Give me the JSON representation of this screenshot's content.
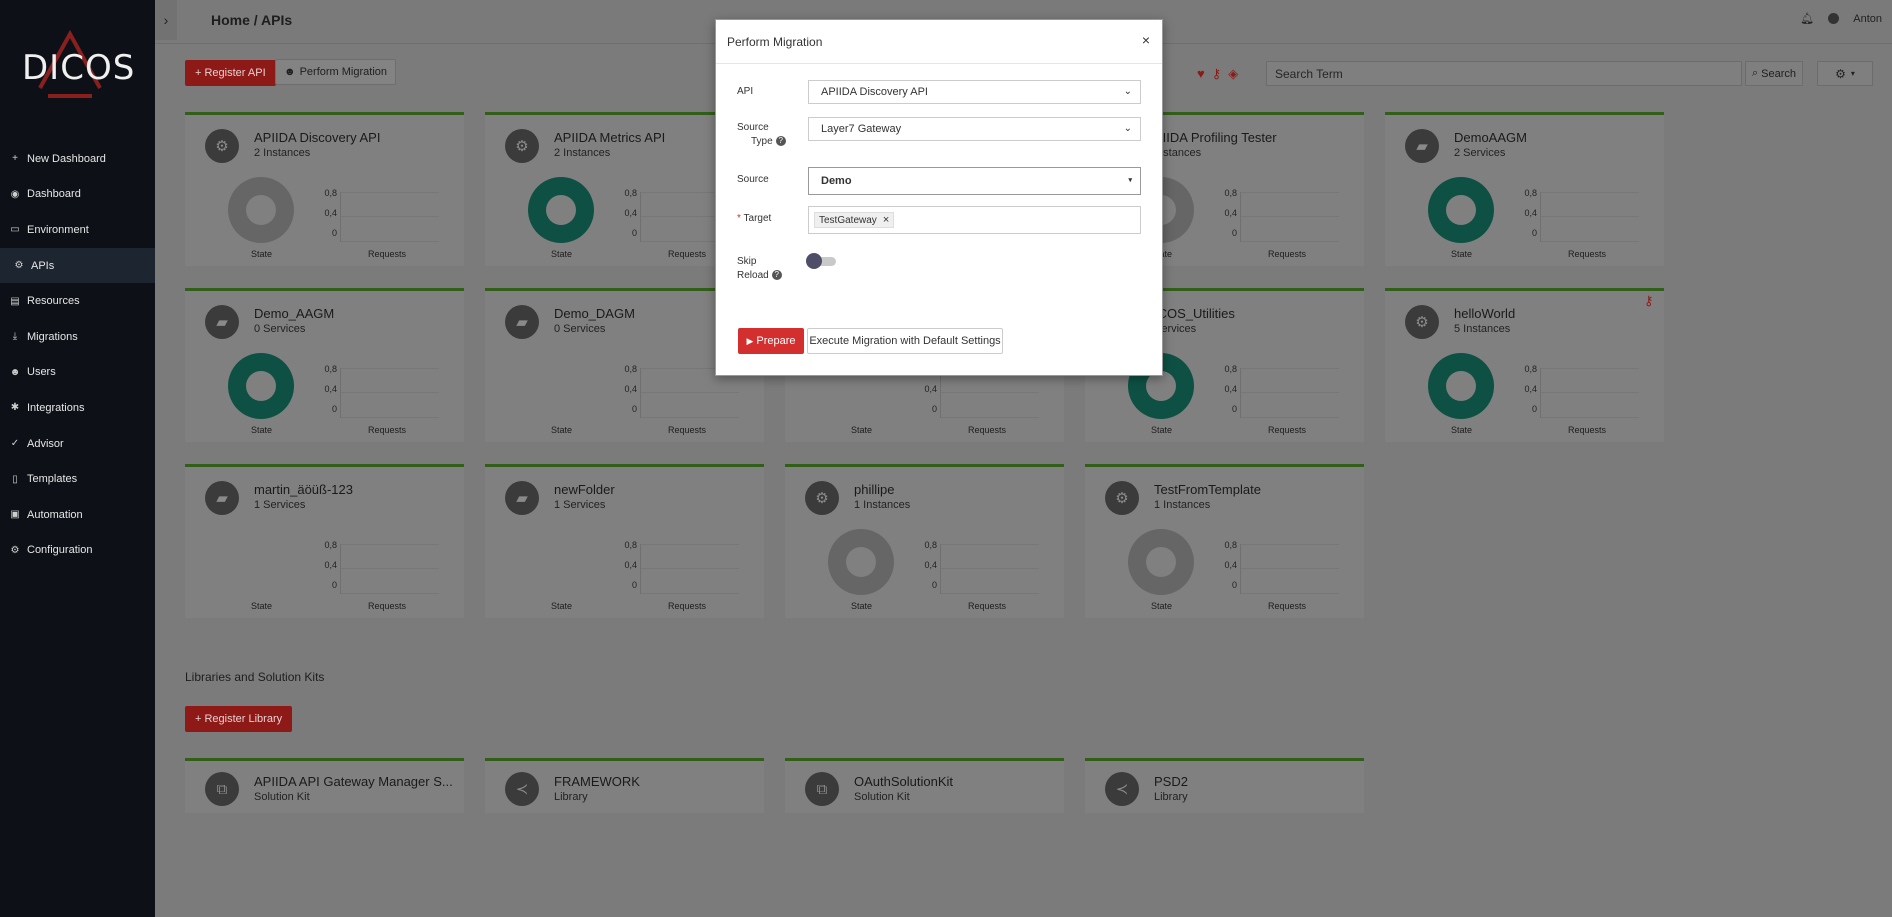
{
  "brand": {
    "logo_text": "DICOS"
  },
  "sidebar": {
    "items": [
      {
        "label": "New Dashboard",
        "icon": "plus-icon"
      },
      {
        "label": "Dashboard",
        "icon": "dashboard-icon"
      },
      {
        "label": "Environment",
        "icon": "monitor-icon"
      },
      {
        "label": "APIs",
        "icon": "api-icon"
      },
      {
        "label": "Resources",
        "icon": "resources-icon"
      },
      {
        "label": "Migrations",
        "icon": "migrations-icon"
      },
      {
        "label": "Users",
        "icon": "users-icon"
      },
      {
        "label": "Integrations",
        "icon": "integrations-icon"
      },
      {
        "label": "Advisor",
        "icon": "check-icon"
      },
      {
        "label": "Templates",
        "icon": "templates-icon"
      },
      {
        "label": "Automation",
        "icon": "automation-icon"
      },
      {
        "label": "Configuration",
        "icon": "gear-icon"
      }
    ]
  },
  "topbar": {
    "breadcrumb": "Home / APIs",
    "user": "Anton"
  },
  "toolbar": {
    "register_api": "+ Register API",
    "perform_migration": "Perform Migration",
    "search_placeholder": "Search Term",
    "search_button": "Search"
  },
  "chart_labels": {
    "state": "State",
    "requests": "Requests",
    "ticks": [
      "0,8",
      "0,4",
      "0"
    ]
  },
  "api_cards": [
    {
      "title": "APIIDA Discovery API",
      "subtitle": "2 Instances",
      "icon": "gears-icon",
      "donut": "grey"
    },
    {
      "title": "APIIDA Metrics API",
      "subtitle": "2 Instances",
      "icon": "gears-icon",
      "donut": "green"
    },
    {
      "title": "",
      "subtitle": "",
      "icon": "",
      "donut": "none"
    },
    {
      "title": "PIIDA Profiling Tester",
      "subtitle": "Instances",
      "icon": "",
      "donut": "grey"
    },
    {
      "title": "DemoAAGM",
      "subtitle": "2 Services",
      "icon": "folder-icon",
      "donut": "green"
    },
    {
      "title": "Demo_AAGM",
      "subtitle": "0 Services",
      "icon": "folder-icon",
      "donut": "green"
    },
    {
      "title": "Demo_DAGM",
      "subtitle": "0 Services",
      "icon": "folder-icon",
      "donut": "none"
    },
    {
      "title": "",
      "subtitle": "",
      "icon": "",
      "donut": "none"
    },
    {
      "title": "ICOS_Utilities",
      "subtitle": "Services",
      "icon": "",
      "donut": "green"
    },
    {
      "title": "helloWorld",
      "subtitle": "5 Instances",
      "icon": "gears-icon",
      "donut": "green"
    },
    {
      "title": "martin_äöüß-123",
      "subtitle": "1 Services",
      "icon": "folder-icon",
      "donut": "none"
    },
    {
      "title": "newFolder",
      "subtitle": "1 Services",
      "icon": "folder-icon",
      "donut": "none"
    },
    {
      "title": "phillipe",
      "subtitle": "1 Instances",
      "icon": "gears-icon",
      "donut": "grey"
    },
    {
      "title": "TestFromTemplate",
      "subtitle": "1 Instances",
      "icon": "gears-icon",
      "donut": "grey"
    }
  ],
  "libraries": {
    "section_title": "Libraries and Solution Kits",
    "register_button": "+ Register Library",
    "cards": [
      {
        "title": "APIIDA API Gateway Manager S...",
        "subtitle": "Solution Kit",
        "icon": "solution-kit-icon"
      },
      {
        "title": "FRAMEWORK",
        "subtitle": "Library",
        "icon": "share-icon"
      },
      {
        "title": "OAuthSolutionKit",
        "subtitle": "Solution Kit",
        "icon": "solution-kit-icon"
      },
      {
        "title": "PSD2",
        "subtitle": "Library",
        "icon": "share-icon"
      }
    ]
  },
  "modal": {
    "title": "Perform Migration",
    "close": "×",
    "api_label": "API",
    "api_value": "APIIDA Discovery API",
    "source_type_label_1": "Source",
    "source_type_label_2": "Type",
    "source_type_value": "Layer7 Gateway",
    "source_label": "Source",
    "source_value": "Demo",
    "target_label": "Target",
    "target_required": "*",
    "target_tag": "TestGateway",
    "skip_label_1": "Skip",
    "skip_label_2": "Reload",
    "skip_reload_on": false,
    "prepare_button": "Prepare",
    "execute_button": "Execute Migration with Default Settings"
  }
}
